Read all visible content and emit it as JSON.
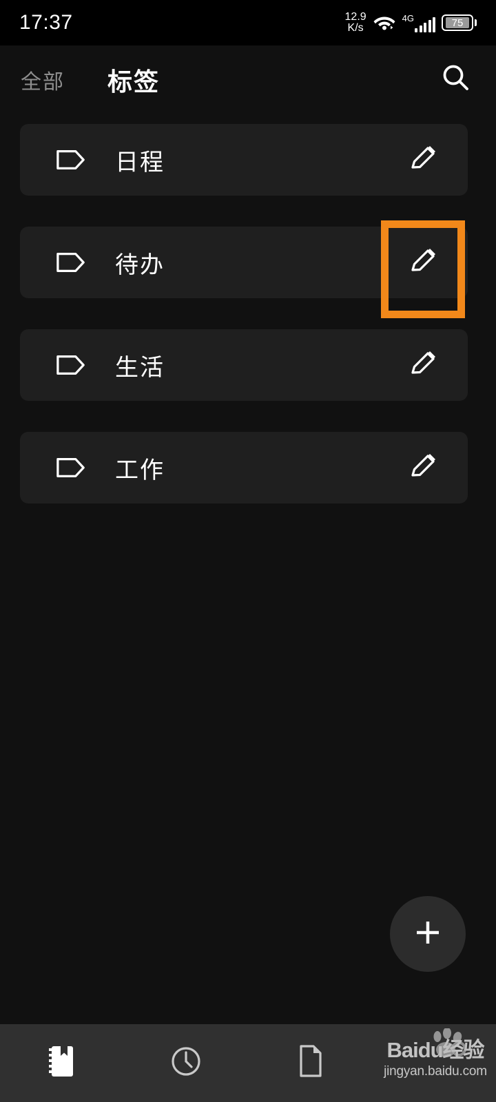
{
  "status_bar": {
    "time": "17:37",
    "net_speed_value": "12.9",
    "net_speed_unit": "K/s",
    "wifi_icon": "wifi-icon",
    "network_type": "4G",
    "signal_icon": "signal-bars-icon",
    "battery_level": "75"
  },
  "header": {
    "tab_all": "全部",
    "tab_tags": "标签",
    "search_icon": "search-icon"
  },
  "tags": [
    {
      "label": "日程",
      "tag_icon": "tag-icon",
      "edit_icon": "pencil-icon"
    },
    {
      "label": "待办",
      "tag_icon": "tag-icon",
      "edit_icon": "pencil-icon"
    },
    {
      "label": "生活",
      "tag_icon": "tag-icon",
      "edit_icon": "pencil-icon"
    },
    {
      "label": "工作",
      "tag_icon": "tag-icon",
      "edit_icon": "pencil-icon"
    }
  ],
  "highlight": {
    "color": "#f2881a",
    "target": "待办 行的编辑按钮"
  },
  "fab": {
    "icon": "plus-icon",
    "label": "+"
  },
  "bottom_nav": [
    {
      "icon": "notebook-icon",
      "active": true
    },
    {
      "icon": "clock-icon",
      "active": false
    },
    {
      "icon": "document-icon",
      "active": false
    },
    {
      "icon": "more-icon",
      "active": false
    }
  ],
  "watermark": {
    "logo_left": "Bai",
    "logo_right": "du经验",
    "url": "jingyan.baidu.com"
  },
  "colors": {
    "page_bg": "#111111",
    "row_bg": "#1f1f1f",
    "nav_bg": "#303030",
    "accent": "#f2881a",
    "text_primary": "#ffffff",
    "text_secondary": "#8e8e8e"
  }
}
